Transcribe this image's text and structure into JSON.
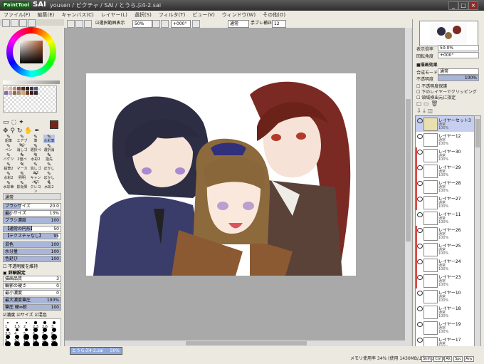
{
  "window": {
    "logo_text": "PaintTool",
    "app_name": "SAI",
    "doc_title": "yousen / ピクチャ / SAI / とうらぶ4-2.sai",
    "buttons": [
      "_",
      "□",
      "×"
    ]
  },
  "menu": [
    "ファイル(F)",
    "編集(E)",
    "キャンバス(C)",
    "レイヤー(L)",
    "選択(S)",
    "フィルタ(T)",
    "ビュー(V)",
    "ウィンドウ(W)",
    "その他(O)"
  ],
  "toolbar": {
    "selection_label": "選択範囲表示",
    "zoom": "50%",
    "rotation": "+000°",
    "blend": "通常",
    "stabilizer_label": "手ブレ補正",
    "stabilizer_value": "12"
  },
  "colors": {
    "main_color": "#7a2417",
    "swatches": [
      "#f2d4c4",
      "#e8b8a2",
      "#c98a6c",
      "#8a4a3a",
      "#5a2a22",
      "#33201a",
      "#3a3550",
      "#5b577a",
      "#7c6fa0",
      "#b9a0c6",
      "#8a6a4a",
      "#a88a64",
      "#c8a87c",
      "#6b3c2a",
      "#401c14",
      "#2a2838"
    ]
  },
  "tools": {
    "pen_tools": [
      "鉛筆",
      "エアブラシ",
      "筆",
      "水彩筆",
      "ペン",
      "消しゴム",
      "選択ペン",
      "選択消し",
      "バケツ",
      "2値ペン",
      "水彩2",
      "指先",
      "鉛筆2",
      "マーカー",
      "消しゴム2",
      "ぼかし",
      "水彩2",
      "照明",
      "キャンバス",
      "ぼかし2",
      "水彩筆",
      "影効果",
      "クレヨン",
      "水彩2"
    ]
  },
  "brush": {
    "mode": "通常",
    "size_label": "ブラシサイズ",
    "size_mult": "x1.0",
    "size_value": "20.0",
    "min_size_label": "最小サイズ",
    "min_size_value": "13%",
    "density_label": "ブラシ濃度",
    "density_value": "100",
    "shape_label": "【通常の円形】",
    "shape_value": "50",
    "texture_label": "【テクスチャなし】",
    "texture_value": "95",
    "blend_label": "混色",
    "blend_value": "100",
    "water_label": "水分量",
    "water_value": "100",
    "persist_label": "色延び",
    "persist_value": "100",
    "keep_opacity_label": "不透明度を維持",
    "detail_label": "詳細設定",
    "quality_label": "描画品質",
    "quality_value": "3",
    "edge_label": "輪郭の硬さ",
    "edge_value": "0",
    "min_density_label": "最小濃度",
    "min_density_value": "0",
    "max_density_label": "最大濃度筆圧",
    "max_density_value": "100%",
    "pressure_label": "筆圧 硬⇔軟",
    "pressure_value": "100",
    "pressure_opts": [
      "濃度",
      "サイズ",
      "混色"
    ]
  },
  "brush_sizes": [
    "1",
    "1.5",
    "2",
    "2.3",
    "2.6",
    "3",
    "3.5",
    "4",
    "5",
    "6",
    "7",
    "8",
    "9",
    "10",
    "12",
    "14",
    "16",
    "20",
    "25",
    "30",
    "35",
    "40",
    "50",
    "60",
    "70",
    "80",
    "100",
    "120",
    "160",
    "200"
  ],
  "right": {
    "zoom_label": "表示倍率",
    "zoom_value": "50.0%",
    "angle_label": "回転角度",
    "angle_value": "+000°",
    "effect_label": "■描画効果",
    "mode_label": "合成モード",
    "mode_value": "通常",
    "opacity_label": "不透明度",
    "opacity_value": "100%",
    "opt1": "不透明度保護",
    "opt2": "下のレイヤーでクリッピング",
    "opt3": "領域検出元に指定"
  },
  "layers": [
    {
      "name": "レイヤーセット3",
      "mode": "通常",
      "opacity": "100%",
      "selected": true,
      "clip": false,
      "folder": true
    },
    {
      "name": "レイヤー12",
      "mode": "通常",
      "opacity": "100%",
      "selected": false,
      "clip": false
    },
    {
      "name": "レイヤー30",
      "mode": "通常",
      "opacity": "100%",
      "selected": false,
      "clip": true
    },
    {
      "name": "レイヤー29",
      "mode": "通常",
      "opacity": "100%",
      "selected": false,
      "clip": true
    },
    {
      "name": "レイヤー28",
      "mode": "通常",
      "opacity": "100%",
      "selected": false,
      "clip": true
    },
    {
      "name": "レイヤー27",
      "mode": "通常",
      "opacity": "100%",
      "selected": false,
      "clip": true
    },
    {
      "name": "レイヤー11",
      "mode": "通常",
      "opacity": "100%",
      "selected": false,
      "clip": false
    },
    {
      "name": "レイヤー26",
      "mode": "通常",
      "opacity": "100%",
      "selected": false,
      "clip": true
    },
    {
      "name": "レイヤー25",
      "mode": "通常",
      "opacity": "100%",
      "selected": false,
      "clip": true
    },
    {
      "name": "レイヤー24",
      "mode": "通常",
      "opacity": "100%",
      "selected": false,
      "clip": true
    },
    {
      "name": "レイヤー23",
      "mode": "通常",
      "opacity": "100%",
      "selected": false,
      "clip": true
    },
    {
      "name": "レイヤー10",
      "mode": "通常",
      "opacity": "100%",
      "selected": false,
      "clip": false
    },
    {
      "name": "レイヤー18",
      "mode": "通常",
      "opacity": "100%",
      "selected": false,
      "clip": false
    },
    {
      "name": "レイヤー19",
      "mode": "通常",
      "opacity": "100%",
      "selected": false,
      "clip": false
    },
    {
      "name": "レイヤー17",
      "mode": "通常",
      "opacity": "100%",
      "selected": false,
      "clip": false
    }
  ],
  "bottom": {
    "doc_tab": "とうらぶ4-2.sai",
    "doc_zoom": "50%",
    "status": "メモリ使用率 34% (使用 1430MB/上限 4095MB)",
    "keys": [
      "Shift",
      "Ctrl",
      "Alt",
      "Spc",
      "Any"
    ]
  }
}
